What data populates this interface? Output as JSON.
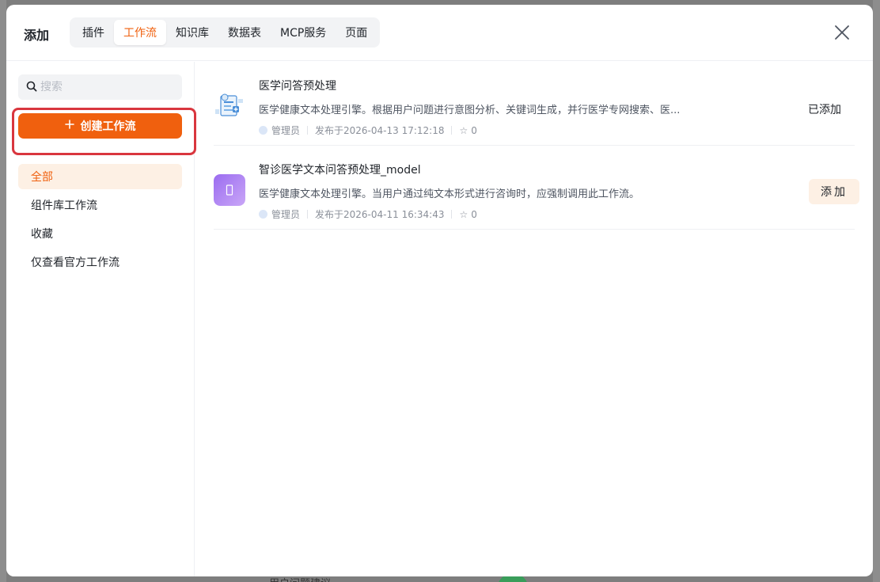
{
  "modal": {
    "title": "添加",
    "tabs": [
      {
        "label": "插件"
      },
      {
        "label": "工作流"
      },
      {
        "label": "知识库"
      },
      {
        "label": "数据表"
      },
      {
        "label": "MCP服务"
      },
      {
        "label": "页面"
      }
    ],
    "active_tab": "工作流"
  },
  "sidebar": {
    "search_placeholder": "搜索",
    "create_button_label": "创建工作流",
    "nav": [
      {
        "label": "全部"
      },
      {
        "label": "组件库工作流"
      },
      {
        "label": "收藏"
      },
      {
        "label": "仅查看官方工作流"
      }
    ]
  },
  "workflows": [
    {
      "title": "医学问答预处理",
      "description": "医学健康文本处理引擎。根据用户问题进行意图分析、关键词生成，并行医学专网搜索、医...",
      "author": "管理员",
      "published": "发布于2026-04-13 17:12:18",
      "stars": "0",
      "status": "已添加"
    },
    {
      "title": "智诊医学文本问答预处理_model",
      "description": "医学健康文本处理引擎。当用户通过纯文本形式进行咨询时，应强制调用此工作流。",
      "author": "管理员",
      "published": "发布于2026-04-11 16:34:43",
      "stars": "0",
      "action": "添加"
    }
  ],
  "background": {
    "partial_text": "用户问题建议"
  },
  "colors": {
    "accent": "#f0600e",
    "accent_soft": "#fdf0e4",
    "highlight_border": "#d9363e"
  }
}
